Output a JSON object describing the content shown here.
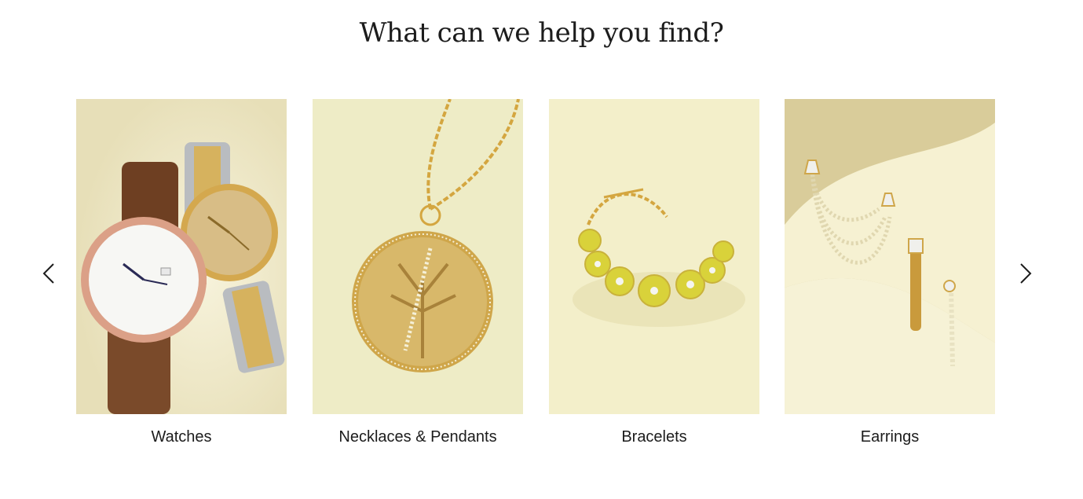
{
  "heading": "What can we help you find?",
  "carousel": {
    "prev_icon": "chevron-left-icon",
    "next_icon": "chevron-right-icon",
    "items": [
      {
        "label": "Watches",
        "icon": "watches-image",
        "bg": "#ece6c4"
      },
      {
        "label": "Necklaces & Pendants",
        "icon": "necklace-image",
        "bg": "#eeecc8"
      },
      {
        "label": "Bracelets",
        "icon": "bracelet-image",
        "bg": "#f3efc9"
      },
      {
        "label": "Earrings",
        "icon": "earrings-image",
        "bg": "#d9cc9a"
      }
    ]
  }
}
